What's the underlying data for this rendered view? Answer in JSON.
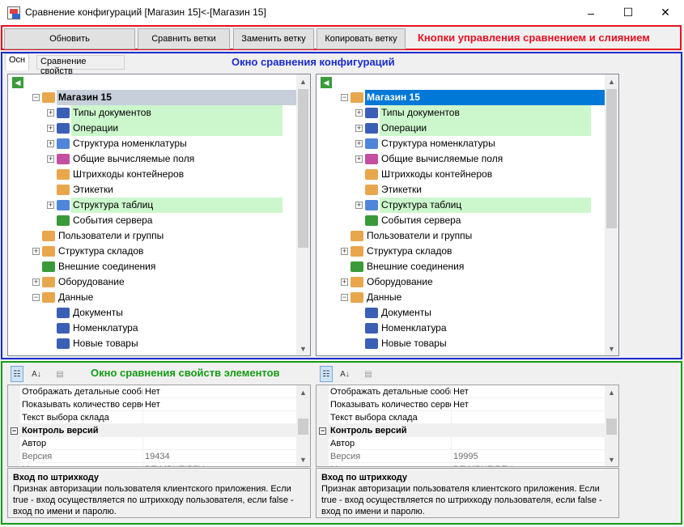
{
  "window": {
    "title": "Сравнение конфигураций [Магазин 15]<-[Магазин 15]",
    "minimize": "–",
    "maximize": "☐",
    "close": "✕"
  },
  "toolbar": {
    "refresh": "Обновить",
    "compare_branches": "Сравнить ветки",
    "replace_branch": "Заменить ветку",
    "copy_branch": "Копировать ветку",
    "caption": "Кнопки управления сравнением и слиянием"
  },
  "tabs": {
    "main": "Осн",
    "props": "Сравнение свойств"
  },
  "compare_caption": "Окно сравнения конфигураций",
  "tree": {
    "nodes": [
      {
        "label": "Магазин 15",
        "bold": true
      },
      {
        "label": "Типы документов",
        "diff": true
      },
      {
        "label": "Операции",
        "diff": true
      },
      {
        "label": "Структура номенклатуры"
      },
      {
        "label": "Общие вычисляемые поля"
      },
      {
        "label": "Штрихкоды контейнеров"
      },
      {
        "label": "Этикетки"
      },
      {
        "label": "Структура таблиц",
        "diff": true
      },
      {
        "label": "События сервера"
      },
      {
        "label": "Пользователи и группы"
      },
      {
        "label": "Структура складов"
      },
      {
        "label": "Внешние соединения"
      },
      {
        "label": "Оборудование"
      },
      {
        "label": "Данные"
      },
      {
        "label": "Документы"
      },
      {
        "label": "Номенклатура"
      },
      {
        "label": "Новые товары"
      }
    ]
  },
  "props_caption": "Окно сравнения свойств элементов",
  "props_left": {
    "rows": [
      {
        "name": "Отображать детальные сообщения",
        "value": "Нет"
      },
      {
        "name": "Показывать количество серверных",
        "value": "Нет"
      },
      {
        "name": "Текст выбора склада",
        "value": ""
      }
    ],
    "category": "Контроль версий",
    "rows2": [
      {
        "name": "Автор",
        "value": ""
      },
      {
        "name": "Версия",
        "value": "19434"
      },
      {
        "name": "М",
        "value": "DT-MBUZIPFV"
      }
    ],
    "desc_title": "Вход по штрихкоду",
    "desc_text": "Признак авторизации пользователя клиентского приложения. Если true - вход осуществляется по штрихкоду пользователя, если false - вход по имени и паролю."
  },
  "props_right": {
    "rows": [
      {
        "name": "Отображать детальные сообщения",
        "value": "Нет"
      },
      {
        "name": "Показывать количество серверных",
        "value": "Нет"
      },
      {
        "name": "Текст выбора склада",
        "value": ""
      }
    ],
    "category": "Контроль версий",
    "rows2": [
      {
        "name": "Автор",
        "value": ""
      },
      {
        "name": "Версия",
        "value": "19995"
      },
      {
        "name": "М",
        "value": "DT-MBUZIPFV"
      }
    ],
    "desc_title": "Вход по штрихкоду",
    "desc_text": "Признак авторизации пользователя клиентского приложения. Если true - вход осуществляется по штрихкоду пользователя, если false - вход по имени и паролю."
  },
  "colors": {
    "diff_bg": "#ccf7cc",
    "selected_bg": "#0078d7",
    "root_left_bg": "#c6cfda",
    "red": "#e81123",
    "blue": "#1a2ccc",
    "green": "#159c15"
  }
}
